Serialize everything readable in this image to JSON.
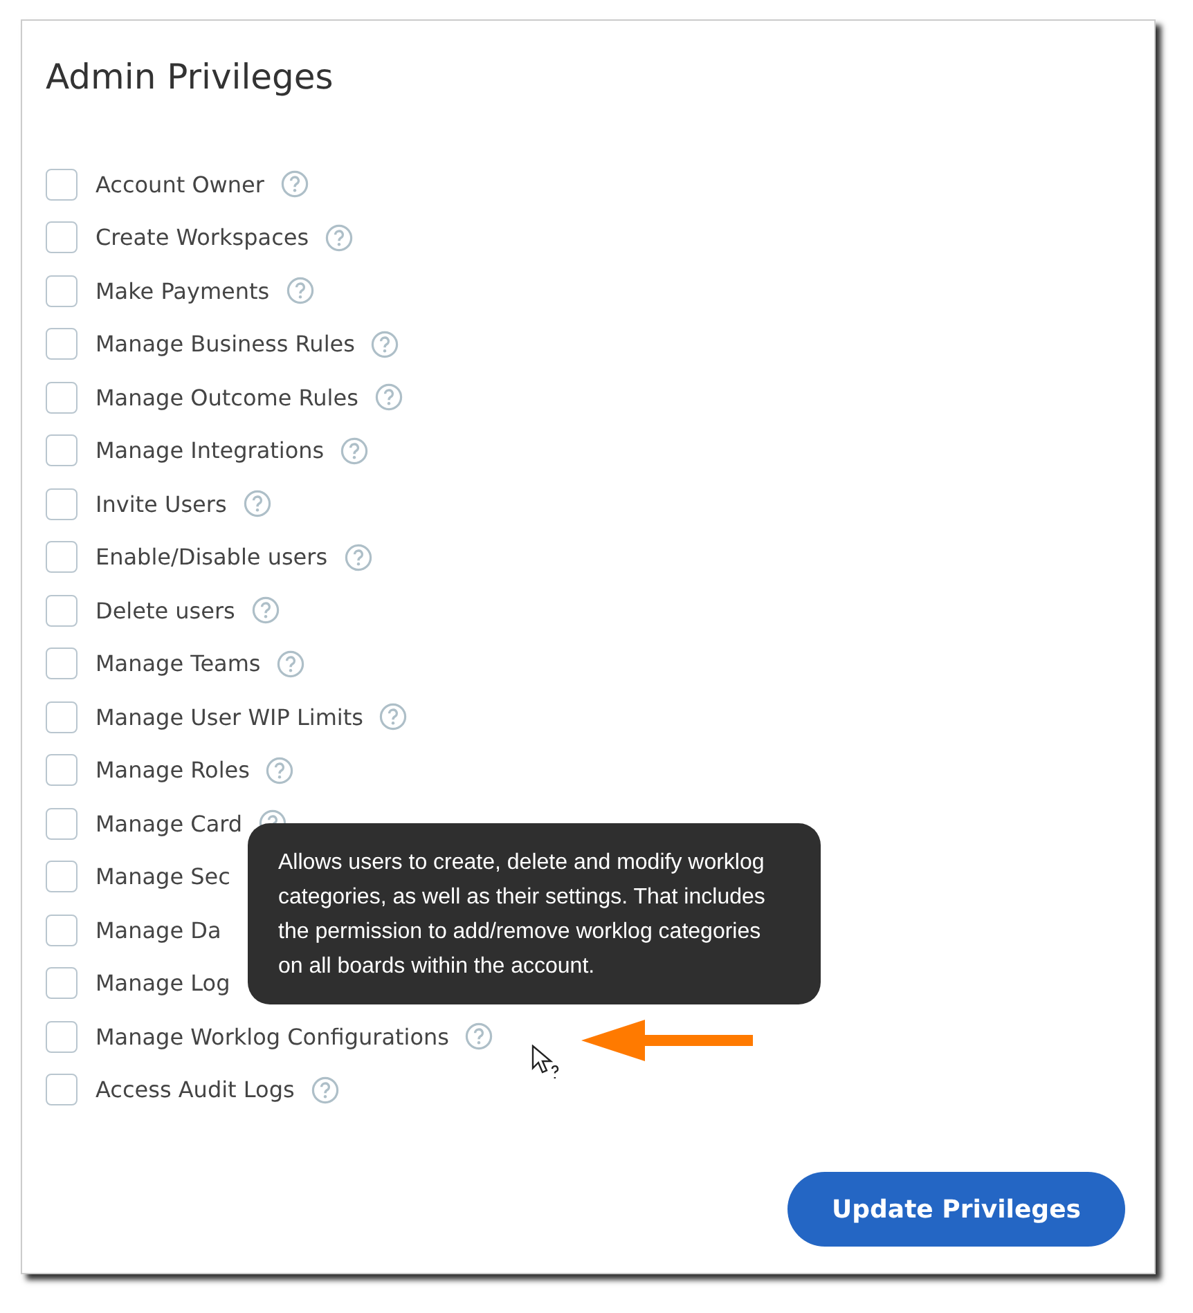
{
  "dialog": {
    "title": "Admin Privileges"
  },
  "privileges": [
    {
      "label": "Account Owner",
      "checked": false,
      "help": true
    },
    {
      "label": "Create Workspaces",
      "checked": false,
      "help": true
    },
    {
      "label": "Make Payments",
      "checked": false,
      "help": true
    },
    {
      "label": "Manage Business Rules",
      "checked": false,
      "help": true
    },
    {
      "label": "Manage Outcome Rules",
      "checked": false,
      "help": true
    },
    {
      "label": "Manage Integrations",
      "checked": false,
      "help": true
    },
    {
      "label": "Invite Users",
      "checked": false,
      "help": true
    },
    {
      "label": "Enable/Disable users",
      "checked": false,
      "help": true
    },
    {
      "label": "Delete users",
      "checked": false,
      "help": true
    },
    {
      "label": "Manage Teams",
      "checked": false,
      "help": true
    },
    {
      "label": "Manage User WIP Limits",
      "checked": false,
      "help": true
    },
    {
      "label": "Manage Roles",
      "checked": false,
      "help": true
    },
    {
      "label": "Manage Card",
      "checked": false,
      "help": true
    },
    {
      "label": "Manage Sec",
      "checked": false,
      "help": false
    },
    {
      "label": "Manage Da",
      "checked": false,
      "help": false
    },
    {
      "label": "Manage Log",
      "checked": false,
      "help": false
    },
    {
      "label": "Manage Worklog Configurations",
      "checked": false,
      "help": true
    },
    {
      "label": "Access Audit Logs",
      "checked": false,
      "help": true
    }
  ],
  "tooltip": {
    "text": "Allows users to create, delete and modify worklog categories, as well as their settings. That includes the permission to add/remove worklog categories on all boards within the account."
  },
  "button": {
    "label": "Update Privileges"
  }
}
